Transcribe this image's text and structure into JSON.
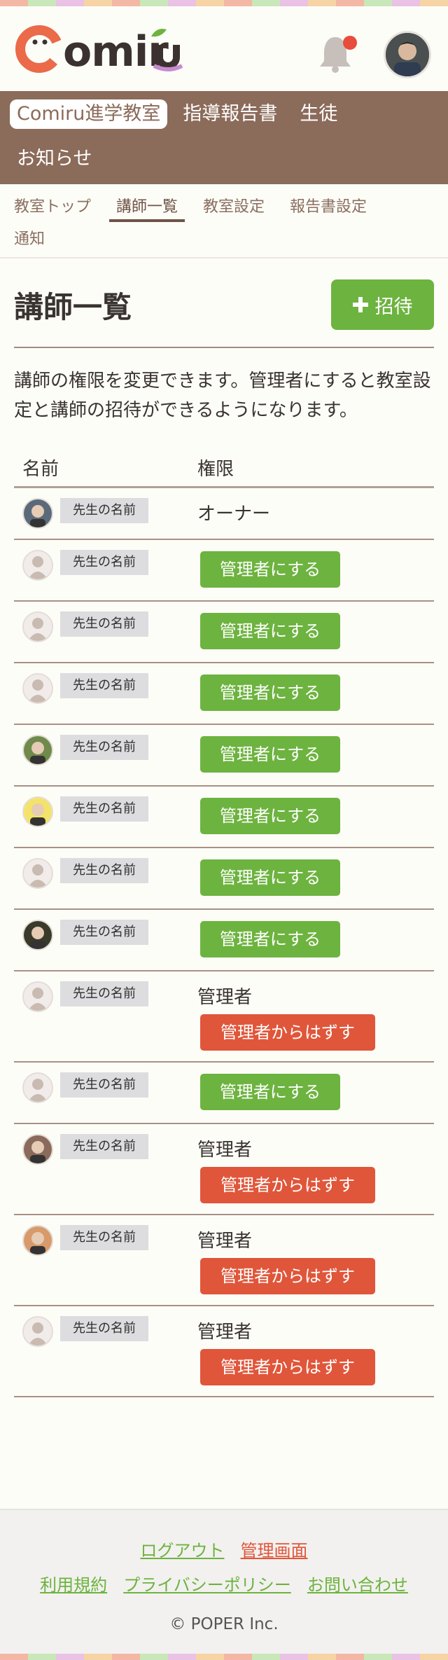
{
  "app": {
    "logo_text": "Comiru"
  },
  "colors": {
    "brand_brown": "#8b6b5a",
    "green": "#6db33f",
    "red": "#e0563a",
    "notification": "#e84c3d"
  },
  "icons": {
    "notification": "bell-icon",
    "invite": "plus-icon"
  },
  "nav": {
    "items": [
      {
        "label": "Comiru進学教室",
        "active": true
      },
      {
        "label": "指導報告書",
        "active": false
      },
      {
        "label": "生徒",
        "active": false
      },
      {
        "label": "お知らせ",
        "active": false
      }
    ]
  },
  "subnav": {
    "items": [
      {
        "label": "教室トップ"
      },
      {
        "label": "講師一覧"
      },
      {
        "label": "教室設定"
      },
      {
        "label": "報告書設定"
      },
      {
        "label": "通知"
      }
    ]
  },
  "page": {
    "title": "講師一覧",
    "invite_label": "招待",
    "description": "講師の権限を変更できます。管理者にすると教室設定と講師の招待ができるようになります。"
  },
  "table": {
    "headers": [
      "名前",
      "権限"
    ],
    "rows": [
      {
        "name": "先生の名前",
        "role": "オーナー",
        "action": ""
      },
      {
        "name": "先生の名前",
        "role": "",
        "action": "管理者にする"
      },
      {
        "name": "先生の名前",
        "role": "",
        "action": "管理者にする"
      },
      {
        "name": "先生の名前",
        "role": "",
        "action": "管理者にする"
      },
      {
        "name": "先生の名前",
        "role": "",
        "action": "管理者にする"
      },
      {
        "name": "先生の名前",
        "role": "",
        "action": "管理者にする"
      },
      {
        "name": "先生の名前",
        "role": "",
        "action": "管理者にする"
      },
      {
        "name": "先生の名前",
        "role": "",
        "action": "管理者にする"
      },
      {
        "name": "先生の名前",
        "role": "管理者",
        "action": "管理者からはずす"
      },
      {
        "name": "先生の名前",
        "role": "",
        "action": "管理者にする"
      },
      {
        "name": "先生の名前",
        "role": "管理者",
        "action": "管理者からはずす"
      },
      {
        "name": "先生の名前",
        "role": "管理者",
        "action": "管理者からはずす"
      },
      {
        "name": "先生の名前",
        "role": "管理者",
        "action": "管理者からはずす"
      }
    ]
  },
  "footer": {
    "logout": "ログアウト",
    "admin": "管理画面",
    "terms": "利用規約",
    "privacy": "プライバシーポリシー",
    "contact": "お問い合わせ",
    "copyright": "© POPER Inc."
  }
}
